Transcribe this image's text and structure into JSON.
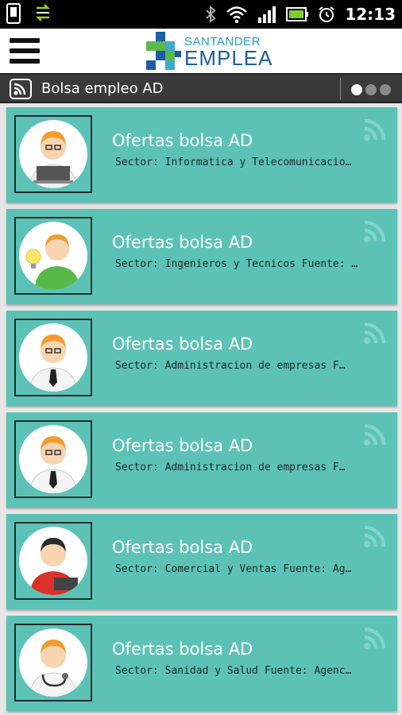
{
  "status_bar": {
    "time": "12:13",
    "icons": [
      "sd-card-icon",
      "usb-transfer-icon",
      "bluetooth-icon",
      "wifi-icon",
      "signal-icon",
      "battery-icon",
      "alarm-icon"
    ]
  },
  "app_bar": {
    "menu_icon": "hamburger-menu-icon",
    "logo_top": "SANTANDER",
    "logo_bottom": "EMPLEA"
  },
  "section": {
    "title": "Bolsa empleo AD",
    "icon": "rss-icon",
    "page_indicator": {
      "total": 3,
      "active": 0
    }
  },
  "colors": {
    "card_bg": "#5cc2b6",
    "section_bg": "#3a3a3a",
    "logo_blue": "#1c5fa3",
    "logo_green": "#5bb84a"
  },
  "offers": [
    {
      "title": "Ofertas bolsa AD",
      "subtitle": "Sector: Informatica y Telecomunicacio…",
      "avatar": "person-laptop-icon"
    },
    {
      "title": "Ofertas bolsa AD",
      "subtitle": "Sector: Ingenieros y Tecnicos Fuente: …",
      "avatar": "person-idea-bulb-icon"
    },
    {
      "title": "Ofertas bolsa AD",
      "subtitle": "Sector: Administracion de empresas F…",
      "avatar": "person-tie-icon"
    },
    {
      "title": "Ofertas bolsa AD",
      "subtitle": "Sector: Administracion de empresas F…",
      "avatar": "person-tie-icon"
    },
    {
      "title": "Ofertas bolsa AD",
      "subtitle": "Sector: Comercial y Ventas Fuente: Ag…",
      "avatar": "person-sales-icon"
    },
    {
      "title": "Ofertas bolsa AD",
      "subtitle": "Sector: Sanidad y Salud Fuente: Agenc…",
      "avatar": "person-doctor-icon"
    }
  ]
}
